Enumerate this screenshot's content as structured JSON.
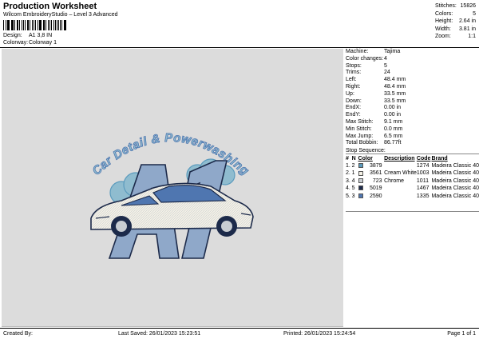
{
  "header": {
    "title": "Production Worksheet",
    "software": "Wilcom EmbroideryStudio – Level 3 Advanced",
    "design_label": "Design:",
    "design_value": "A1 3,8 IN",
    "colorway_label": "Colorway:",
    "colorway_value": "Colorway 1"
  },
  "stats": [
    {
      "label": "Stitches:",
      "value": "15826"
    },
    {
      "label": "Colors:",
      "value": "5"
    },
    {
      "label": "Height:",
      "value": "2.64 in"
    },
    {
      "label": "Width:",
      "value": "3.81 in"
    },
    {
      "label": "Zoom:",
      "value": "1:1"
    }
  ],
  "details": [
    {
      "label": "Machine:",
      "value": "Tajima"
    },
    {
      "label": "Color changes:",
      "value": "4"
    },
    {
      "label": "Stops:",
      "value": "5"
    },
    {
      "label": "Trims:",
      "value": "24"
    },
    {
      "label": "Left:",
      "value": "48.4 mm"
    },
    {
      "label": "Right:",
      "value": "48.4 mm"
    },
    {
      "label": "Up:",
      "value": "33.5 mm"
    },
    {
      "label": "Down:",
      "value": "33.5 mm"
    },
    {
      "label": "EndX:",
      "value": "0.00 in"
    },
    {
      "label": "EndY:",
      "value": "0.00 in"
    },
    {
      "label": "Max Stitch:",
      "value": "9.1 mm"
    },
    {
      "label": "Min Stitch:",
      "value": "0.0 mm"
    },
    {
      "label": "Max Jump:",
      "value": "6.5 mm"
    },
    {
      "label": "Total Bobbin:",
      "value": "86.77ft"
    }
  ],
  "stop_sequence_label": "Stop Sequence:",
  "stops_table": {
    "headers": [
      "#",
      "N",
      "Color",
      "Description",
      "Code",
      "Brand"
    ],
    "rows": [
      {
        "stop": "1.",
        "n": "2",
        "color_code": "3879",
        "description": "",
        "code": "1274",
        "brand": "Madeira Classic 40",
        "swatch": "#5b9bbd"
      },
      {
        "stop": "2.",
        "n": "1",
        "color_code": "3561",
        "description": "Cream White",
        "code": "1003",
        "brand": "Madeira Classic 40",
        "swatch": "#f4f1e6"
      },
      {
        "stop": "3.",
        "n": "4",
        "color_code": "723",
        "description": "Chrome",
        "code": "1011",
        "brand": "Madeira Classic 40",
        "swatch": "#c8cdd2"
      },
      {
        "stop": "4.",
        "n": "5",
        "color_code": "5019",
        "description": "",
        "code": "1467",
        "brand": "Madeira Classic 40",
        "swatch": "#1c2a4a"
      },
      {
        "stop": "5.",
        "n": "3",
        "color_code": "2590",
        "description": "",
        "code": "1335",
        "brand": "Madeira Classic 40",
        "swatch": "#4f76b0"
      }
    ]
  },
  "artwork": {
    "arc_text": "Car Detail & Powerwashing",
    "big_text": "A1",
    "colors": {
      "teal": "#5b9bbd",
      "blue": "#4f76b0",
      "navy": "#1c2a4a",
      "cream": "#f4f1e6",
      "chrome": "#c8cdd2"
    }
  },
  "footer": {
    "created_by": "Created By:",
    "last_saved": "Last Saved: 26/01/2023 15:23:51",
    "printed": "Printed: 26/01/2023 15:24:54",
    "page": "Page 1 of 1"
  }
}
